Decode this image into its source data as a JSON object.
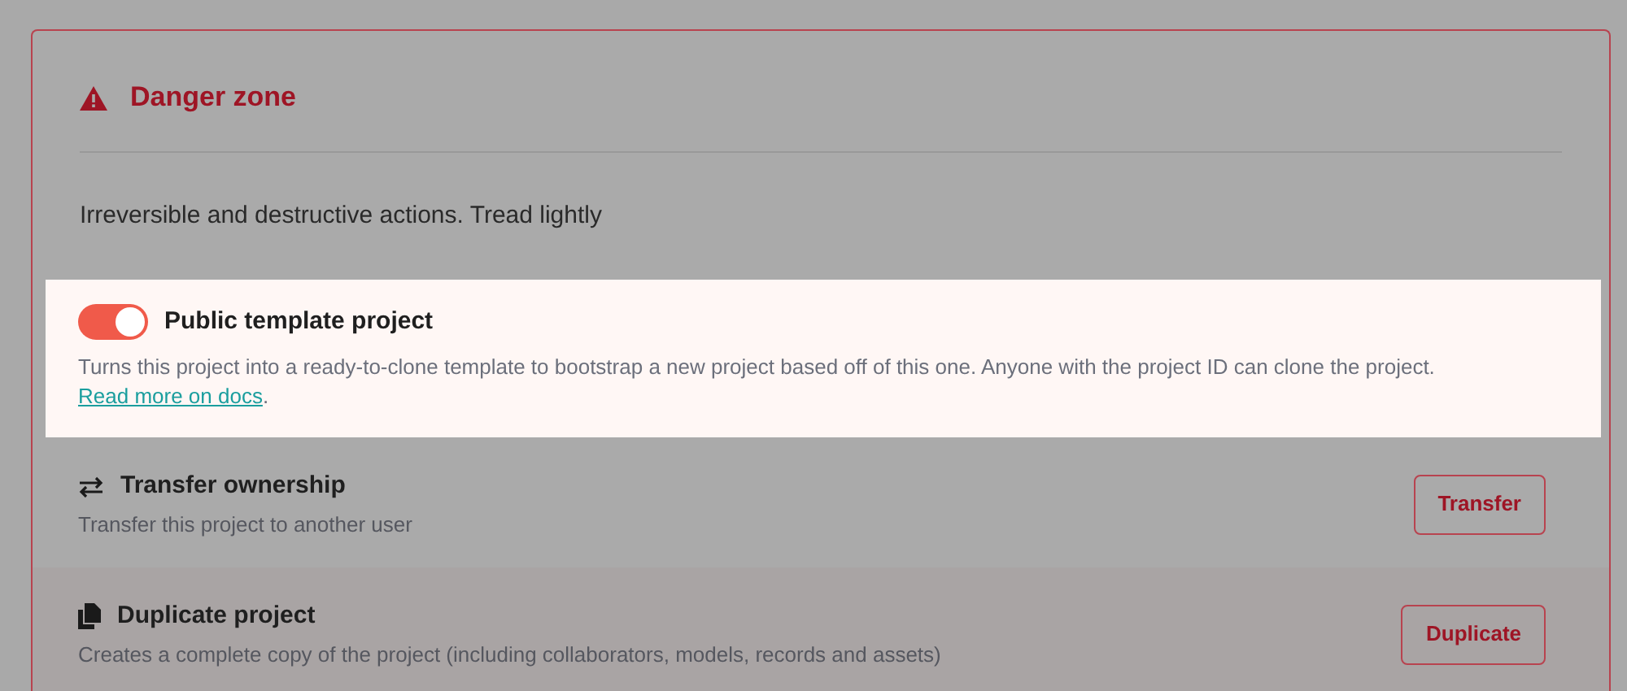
{
  "section": {
    "title": "Danger zone",
    "description": "Irreversible and destructive actions. Tread lightly"
  },
  "public_template": {
    "on": true,
    "title": "Public template project",
    "description": "Turns this project into a ready-to-clone template to bootstrap a new project based off of this one. Anyone with the project ID can clone the project.",
    "link": "Read more on docs",
    "after_link": "."
  },
  "actions": [
    {
      "kind": "transfer",
      "title": "Transfer ownership",
      "description": "Transfer this project to another user",
      "button": "Transfer"
    },
    {
      "kind": "duplicate",
      "title": "Duplicate project",
      "description": "Creates a complete copy of the project (including collaborators, models, records and assets)",
      "button": "Duplicate"
    }
  ]
}
